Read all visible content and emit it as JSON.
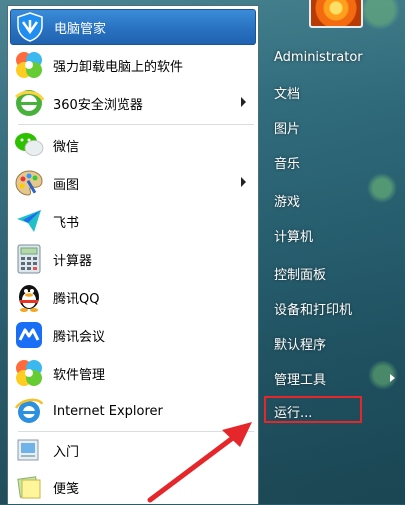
{
  "left_menu": {
    "items": [
      {
        "label": "电脑管家",
        "icon": "shield-icon",
        "highlight": true,
        "arrow": false
      },
      {
        "label": "强力卸载电脑上的软件",
        "icon": "colorful-clover-icon",
        "arrow": false
      },
      {
        "label": "360安全浏览器",
        "icon": "browser-360-icon",
        "arrow": true
      },
      {
        "label": "微信",
        "icon": "wechat-icon",
        "arrow": false
      },
      {
        "label": "画图",
        "icon": "paint-palette-icon",
        "arrow": true
      },
      {
        "label": "飞书",
        "icon": "paper-plane-icon",
        "arrow": false
      },
      {
        "label": "计算器",
        "icon": "calculator-icon",
        "arrow": false
      },
      {
        "label": "腾讯QQ",
        "icon": "qq-penguin-icon",
        "arrow": false
      },
      {
        "label": "腾讯会议",
        "icon": "meeting-icon",
        "arrow": false
      },
      {
        "label": "软件管理",
        "icon": "colorful-clover-icon",
        "arrow": false
      },
      {
        "label": "Internet Explorer",
        "icon": "ie-icon",
        "arrow": false
      },
      {
        "label": "入门",
        "icon": "getting-started-icon",
        "arrow": false
      },
      {
        "label": "便笺",
        "icon": "sticky-note-icon",
        "arrow": false
      }
    ]
  },
  "right_menu": {
    "user": "Administrator",
    "items": [
      {
        "label": "文档"
      },
      {
        "label": "图片"
      },
      {
        "label": "音乐"
      },
      {
        "label": "游戏"
      },
      {
        "label": "计算机"
      },
      {
        "label": "控制面板"
      },
      {
        "label": "设备和打印机"
      },
      {
        "label": "默认程序"
      },
      {
        "label": "管理工具"
      },
      {
        "label": "运行..."
      }
    ]
  },
  "colors": {
    "highlight": "#2a74c3",
    "annotation_red": "#e5262a"
  }
}
